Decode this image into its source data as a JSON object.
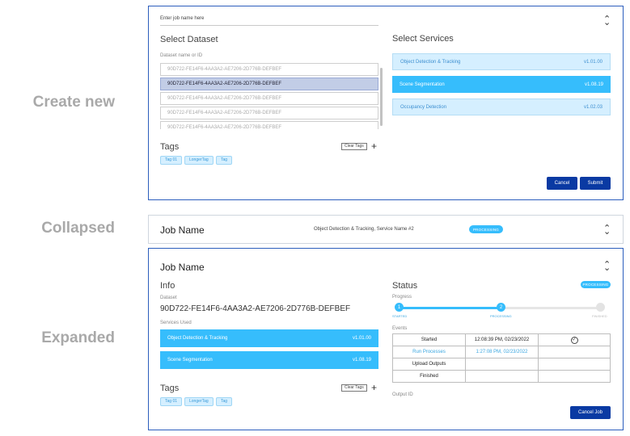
{
  "labels": {
    "create": "Create new",
    "collapsed": "Collapsed",
    "expanded": "Expanded"
  },
  "create": {
    "job_name_placeholder": "Enter job name here",
    "select_dataset": "Select Dataset",
    "dataset_label": "Dataset name or ID",
    "datasets": [
      "90D722-FE14F6-4AA3A2-AE7206-2D776B-DEFBEF",
      "90D722-FE14F6-4AA3A2-AE7206-2D776B-DEFBEF",
      "90D722-FE14F6-4AA3A2-AE7206-2D776B-DEFBEF",
      "90D722-FE14F6-4AA3A2-AE7206-2D776B-DEFBEF",
      "90D722-FE14F6-4AA3A2-AE7206-2D776B-DEFBEF"
    ],
    "select_services": "Select Services",
    "services": [
      {
        "name": "Object Detection & Tracking",
        "version": "v1.01.00"
      },
      {
        "name": "Scene Segmentation",
        "version": "v1.08.19"
      },
      {
        "name": "Occupancy Detection",
        "version": "v1.02.03"
      }
    ],
    "tags_title": "Tags",
    "clear_tags": "Clear Tags",
    "tags": [
      "Tag 01",
      "LongerTag",
      "Tag"
    ],
    "cancel": "Cancel",
    "submit": "Submit"
  },
  "collapsed": {
    "job_name": "Job Name",
    "services": "Object Detection & Tracking, Service Name #2",
    "status": "PROCESSING"
  },
  "expanded": {
    "job_name": "Job Name",
    "info": "Info",
    "dataset_label": "Dataset",
    "dataset_id": "90D722-FE14F6-4AA3A2-AE7206-2D776B-DEFBEF",
    "services_used": "Services Used",
    "services": [
      {
        "name": "Object Detection & Tracking",
        "version": "v1.01.00"
      },
      {
        "name": "Scene Segmentation",
        "version": "v1.08.19"
      }
    ],
    "tags_title": "Tags",
    "clear_tags": "Clear Tags",
    "tags": [
      "Tag 01",
      "LongerTag",
      "Tag"
    ],
    "status_title": "Status",
    "status_badge": "PROCESSING",
    "progress_label": "Progress",
    "steps": [
      {
        "num": "1",
        "label": "STARTED"
      },
      {
        "num": "2",
        "label": "PROCESSING"
      },
      {
        "num": "",
        "label": "FINISHED"
      }
    ],
    "progress_fraction": 0.5,
    "events_label": "Events",
    "events": [
      {
        "name": "Started",
        "time": "12:08:39 PM, 02/23/2022",
        "done": true
      },
      {
        "name": "Run Processes",
        "time": "1:27:08 PM, 02/23/2022",
        "done": false
      },
      {
        "name": "Upload Outputs",
        "time": "",
        "done": false
      },
      {
        "name": "Finished",
        "time": "",
        "done": false
      }
    ],
    "output_id_label": "Output ID",
    "cancel_job": "Cancel Job"
  }
}
